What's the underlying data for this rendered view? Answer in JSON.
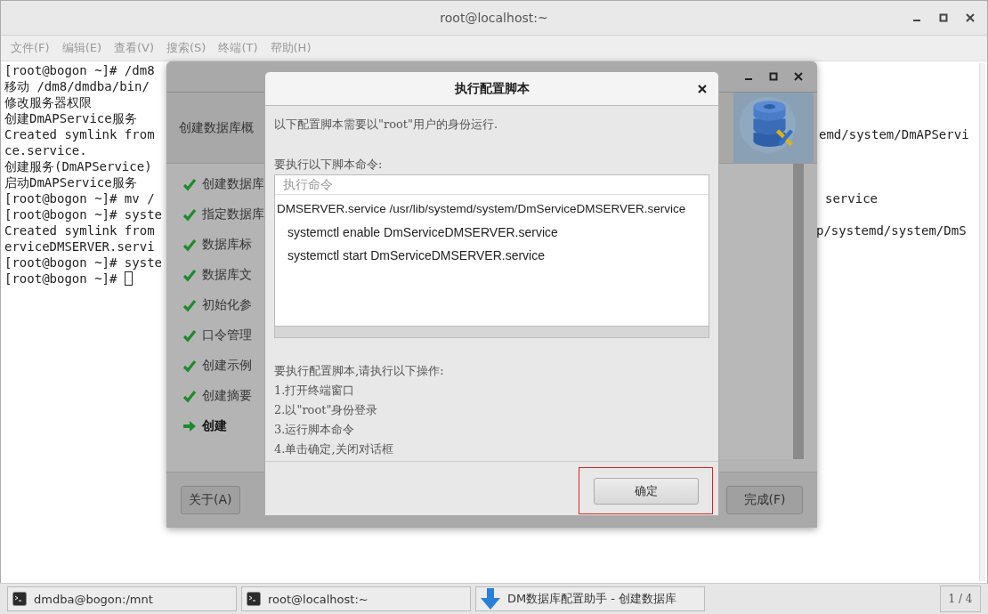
{
  "terminal": {
    "title": "root@localhost:~",
    "menu": [
      "文件(F)",
      "编辑(E)",
      "查看(V)",
      "搜索(S)",
      "终端(T)",
      "帮助(H)"
    ],
    "lines": [
      {
        "left": "[root@bogon ~]# /dm8"
      },
      {
        "left": "移动 /dm8/dmdba/bin/"
      },
      {
        "left": "修改服务器权限"
      },
      {
        "left": "创建DmAPService服务"
      },
      {
        "left": "Created symlink from",
        "right": "emd/system/DmAPServi"
      },
      {
        "left": "ce.service."
      },
      {
        "left": "创建服务(DmAPService)"
      },
      {
        "left": "启动DmAPService服务"
      },
      {
        "left": "[root@bogon ~]# mv /",
        "right": "service"
      },
      {
        "left": "[root@bogon ~]# syste"
      },
      {
        "left": "Created symlink from",
        "right": "p/systemd/system/DmS"
      },
      {
        "left": "erviceDMSERVER.servi"
      },
      {
        "left": "[root@bogon ~]# syste"
      },
      {
        "left": "[root@bogon ~]# ",
        "cursor": true
      }
    ]
  },
  "wizard": {
    "header": "创建数据库概",
    "steps": [
      {
        "label": "创建数据库",
        "kind": "done"
      },
      {
        "label": "指定数据库",
        "kind": "done"
      },
      {
        "label": "数据库标",
        "kind": "done"
      },
      {
        "label": "数据库文",
        "kind": "done"
      },
      {
        "label": "初始化参",
        "kind": "done"
      },
      {
        "label": "口令管理",
        "kind": "done"
      },
      {
        "label": "创建示例",
        "kind": "done"
      },
      {
        "label": "创建摘要",
        "kind": "done"
      },
      {
        "label": "创建",
        "kind": "current"
      }
    ],
    "buttons": [
      "关于(A)",
      "完成(F)"
    ]
  },
  "dialog": {
    "title": "执行配置脚本",
    "intro": "以下配置脚本需要以\"root\"用户的身份运行.",
    "commands_label": "要执行以下脚本命令:",
    "table": {
      "column": "执行命令",
      "rows": [
        "DMSERVER.service /usr/lib/systemd/system/DmServiceDMSERVER.service",
        " systemctl enable DmServiceDMSERVER.service",
        " systemctl start DmServiceDMSERVER.service"
      ]
    },
    "steps_label": "要执行配置脚本,请执行以下操作:",
    "steps": [
      "1.打开终端窗口",
      "2.以\"root\"身份登录",
      "3.运行脚本命令",
      "4.单击确定,关闭对话框"
    ],
    "ok_button": "确定"
  },
  "taskbar": {
    "items": [
      {
        "label": "dmdba@bogon:/mnt",
        "kind": "terminal"
      },
      {
        "label": "root@localhost:~",
        "kind": "terminal"
      },
      {
        "label": "DM数据库配置助手 - 创建数据库",
        "kind": "download"
      }
    ],
    "pager": "1 / 4"
  }
}
